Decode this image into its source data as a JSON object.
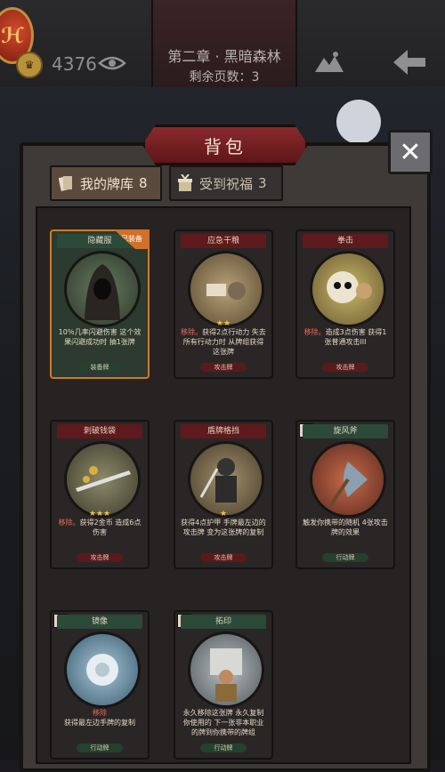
{
  "topbar": {
    "gold": "4376",
    "chapter_title": "第二章 · 黑暗森林",
    "pages_left": "剩余页数：3"
  },
  "bag": {
    "title": "背包",
    "close_label": "✕",
    "tabs": [
      {
        "label": "我的牌库",
        "count": "8"
      },
      {
        "label": "受到祝福",
        "count": "3"
      }
    ]
  },
  "cards": [
    {
      "name": "隐藏服",
      "desc": "10％几率闪避伤害 这个效果闪避成功时 抽1张牌",
      "type": "装备牌",
      "badge": "已装备",
      "stars": ""
    },
    {
      "name": "应急干粮",
      "desc_hl": "移除。",
      "desc": "获得2点行动力 失去所有行动力时 从牌组获得这张牌",
      "type": "攻击牌",
      "stars": "★★"
    },
    {
      "name": "拳击",
      "desc_hl": "移除。",
      "desc": "造成3点伤害 获得1张普通攻击III",
      "type": "攻击牌",
      "stars": ""
    },
    {
      "name": "刺破钱袋",
      "desc_hl": "移除。",
      "desc": "获得2金币 造成6点伤害",
      "type": "攻击牌",
      "stars": "★★★"
    },
    {
      "name": "盾牌格挡",
      "desc": "获得4点护甲 手牌最左边的攻击牌 变为这张牌的复制",
      "type": "攻击牌",
      "stars": "★"
    },
    {
      "name": "旋风斧",
      "desc": "触发你携带的随机 4张攻击牌的效果",
      "type": "行动牌",
      "tier": "I",
      "stars": ""
    },
    {
      "name": "镜像",
      "desc_hl": "移除",
      "desc": "获得最左边手牌的复制",
      "type": "行动牌",
      "tier": "I",
      "stars": ""
    },
    {
      "name": "拓印",
      "desc": "永久移除这张牌 永久复制你使用的 下一张非本职业 的牌到你携带的牌组",
      "type": "行动牌",
      "tier": "0",
      "stars": ""
    }
  ]
}
